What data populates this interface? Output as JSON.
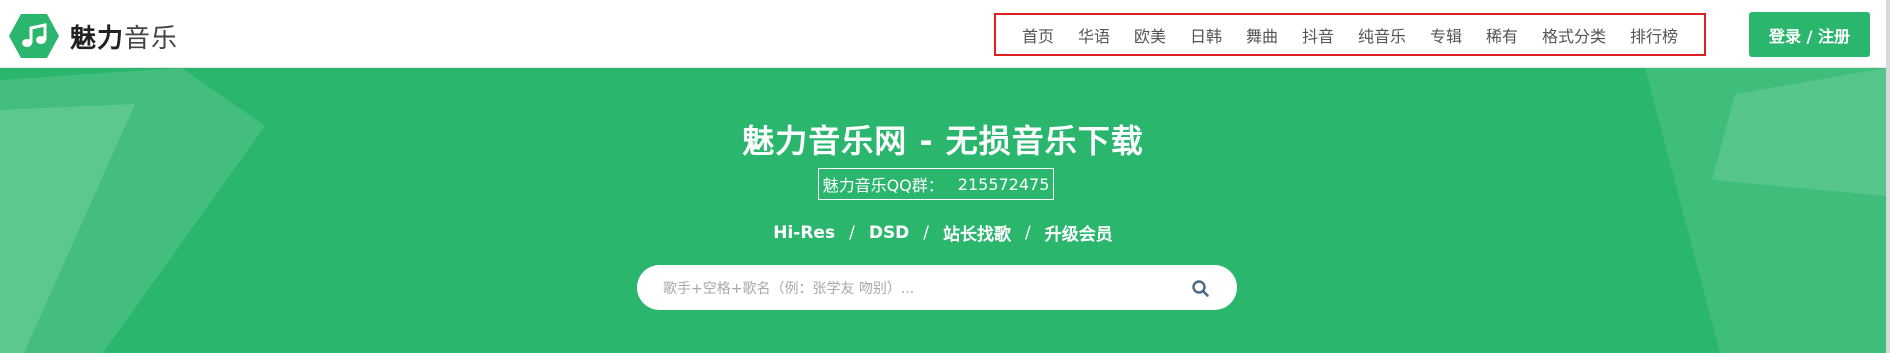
{
  "header": {
    "logo_bold": "魅力",
    "logo_light": "音乐",
    "nav": [
      "首页",
      "华语",
      "欧美",
      "日韩",
      "舞曲",
      "抖音",
      "纯音乐",
      "专辑",
      "稀有",
      "格式分类",
      "排行榜"
    ],
    "login_label": "登录 / 注册"
  },
  "hero": {
    "title": "魅力音乐网 - 无损音乐下载",
    "qq_label": "魅力音乐QQ群：",
    "qq_number": "215572475",
    "links": [
      "Hi-Res",
      "DSD",
      "站长找歌",
      "升级会员"
    ],
    "link_separator": "/"
  },
  "search": {
    "placeholder": "歌手+空格+歌名（例：张学友 吻别）...",
    "icon": "search-icon"
  },
  "colors": {
    "brand_green": "#2ab66d",
    "highlight_red": "#e02020"
  }
}
